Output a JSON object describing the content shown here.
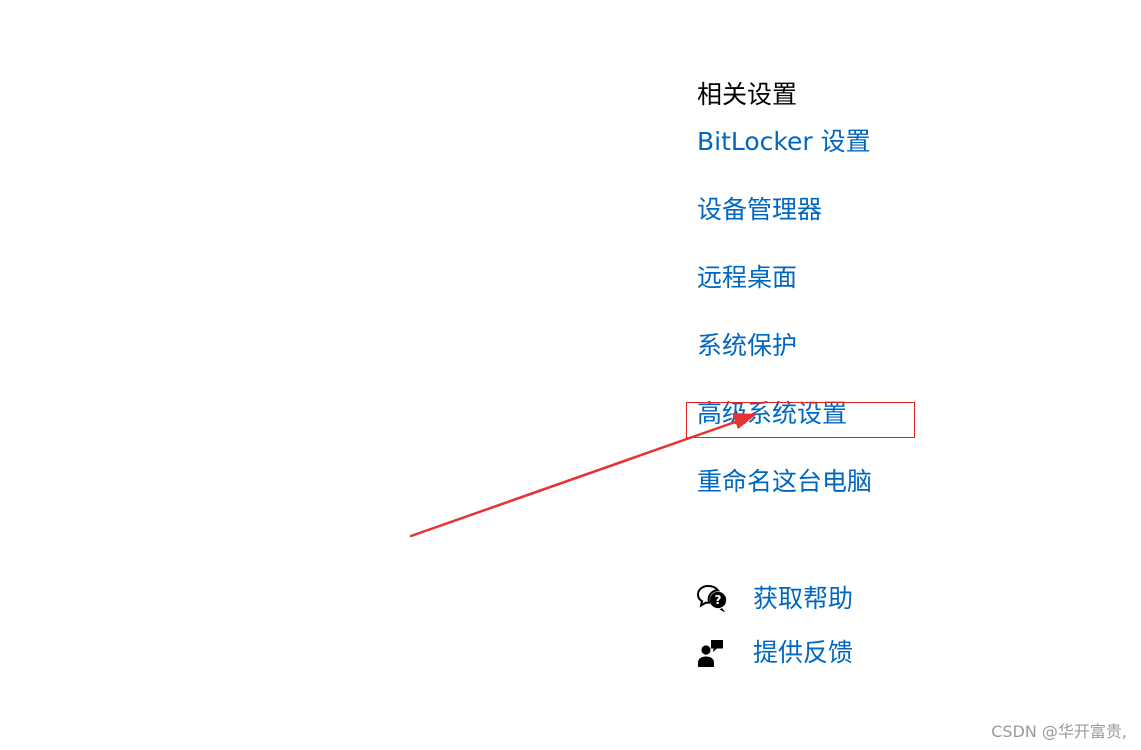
{
  "related_settings": {
    "title": "相关设置",
    "links": [
      {
        "label": "BitLocker 设置"
      },
      {
        "label": "设备管理器"
      },
      {
        "label": "远程桌面"
      },
      {
        "label": "系统保护"
      },
      {
        "label": "高级系统设置"
      },
      {
        "label": "重命名这台电脑"
      }
    ]
  },
  "help": {
    "get_help": {
      "label": "获取帮助",
      "icon": "help-chat-icon"
    },
    "feedback": {
      "label": "提供反馈",
      "icon": "feedback-person-icon"
    }
  },
  "annotation": {
    "box_color": "#e02424",
    "arrow_color": "#e63232"
  },
  "watermark": "CSDN @华开富贵,"
}
